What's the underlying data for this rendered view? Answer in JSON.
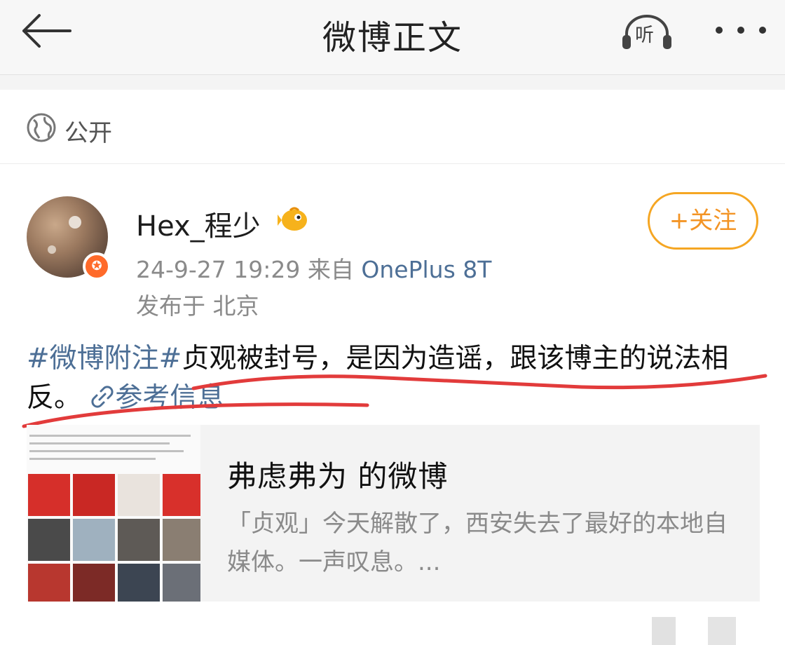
{
  "header": {
    "title": "微博正文",
    "listen_label": "听"
  },
  "visibility": {
    "label": "公开"
  },
  "post": {
    "username": "Hex_程少",
    "timestamp": "24-9-27 19:29",
    "source_prefix": "来自",
    "source": "OnePlus 8T",
    "location": "发布于 北京",
    "follow_label": "+关注",
    "hashtag": "#微博附注#",
    "text": "贞观被封号，是因为造谣，跟该博主的说法相反。",
    "ref_label": "参考信息"
  },
  "card": {
    "title": "弗虑弗为 的微博",
    "summary": "「贞观」今天解散了，西安失去了最好的本地自媒体。一声叹息。..."
  },
  "colors": {
    "link": "#4d6f96",
    "follow": "#f39425",
    "annotation": "#e23b3b"
  }
}
